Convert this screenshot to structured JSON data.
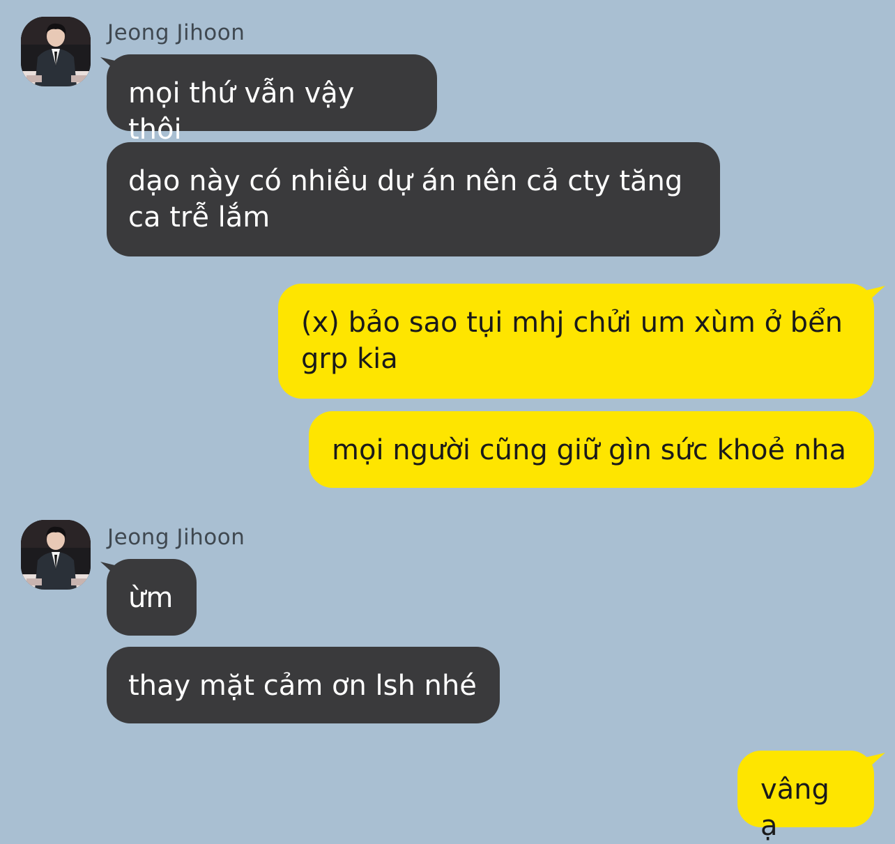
{
  "colors": {
    "background": "#a9bfd2",
    "incoming_bubble": "#3a3a3c",
    "outgoing_bubble": "#fee500"
  },
  "messages": [
    {
      "sender": "Jeong Jihoon",
      "direction": "incoming",
      "text": "mọi thứ vẫn vậy thôi"
    },
    {
      "sender": "Jeong Jihoon",
      "direction": "incoming",
      "text": "dạo này có nhiều dự án nên cả cty tăng ca trễ lắm"
    },
    {
      "direction": "outgoing",
      "text": "(x) bảo sao tụi mhj chửi um xùm ở bển grp kia"
    },
    {
      "direction": "outgoing",
      "text": "mọi người cũng giữ gìn sức khoẻ nha"
    },
    {
      "sender": "Jeong Jihoon",
      "direction": "incoming",
      "text": "ừm"
    },
    {
      "sender": "Jeong Jihoon",
      "direction": "incoming",
      "text": "thay mặt cảm ơn lsh nhé"
    },
    {
      "direction": "outgoing",
      "text": "vâng ạ"
    }
  ],
  "groups": [
    {
      "sender_name": "Jeong Jihoon",
      "avatar_icon": "profile-photo-man-in-suit"
    },
    {
      "sender_name": "Jeong Jihoon",
      "avatar_icon": "profile-photo-man-in-suit"
    }
  ]
}
